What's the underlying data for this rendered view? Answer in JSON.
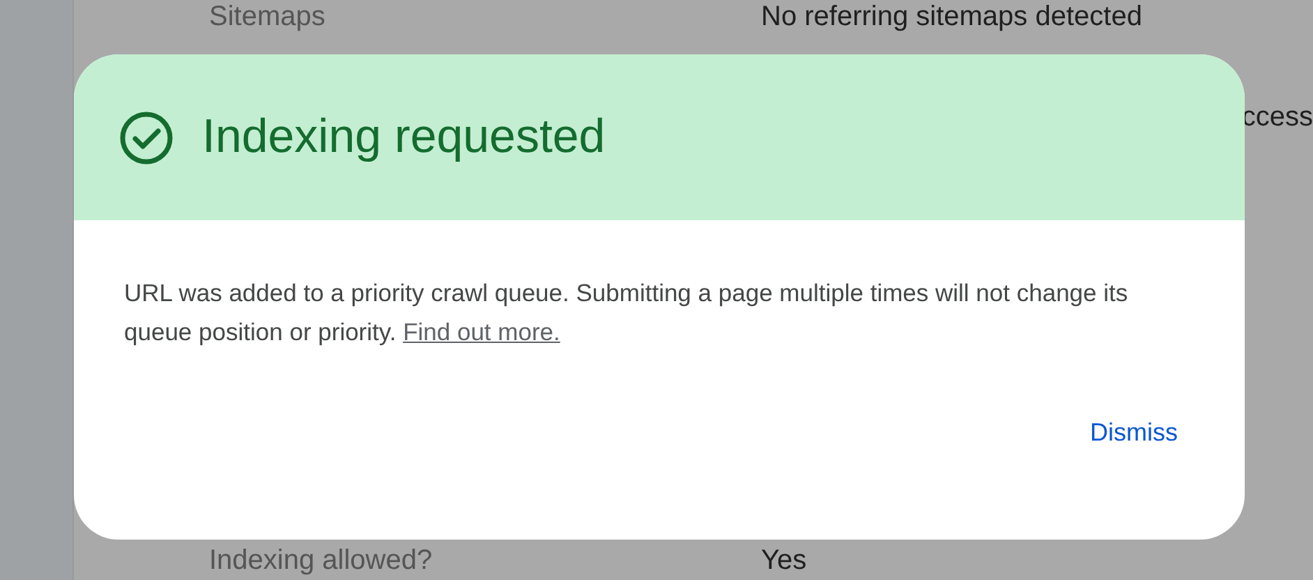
{
  "background": {
    "rows": [
      {
        "label": "Sitemaps",
        "value": "No referring sitemaps detected"
      },
      {
        "label": "",
        "value": "ccess"
      },
      {
        "label": "Indexing allowed?",
        "value": "Yes"
      }
    ]
  },
  "dialog": {
    "title": "Indexing requested",
    "message": "URL was added to a priority crawl queue. Submitting a page multiple times will not change its queue position or priority.",
    "link": "Find out more.",
    "button": "Dismiss"
  }
}
